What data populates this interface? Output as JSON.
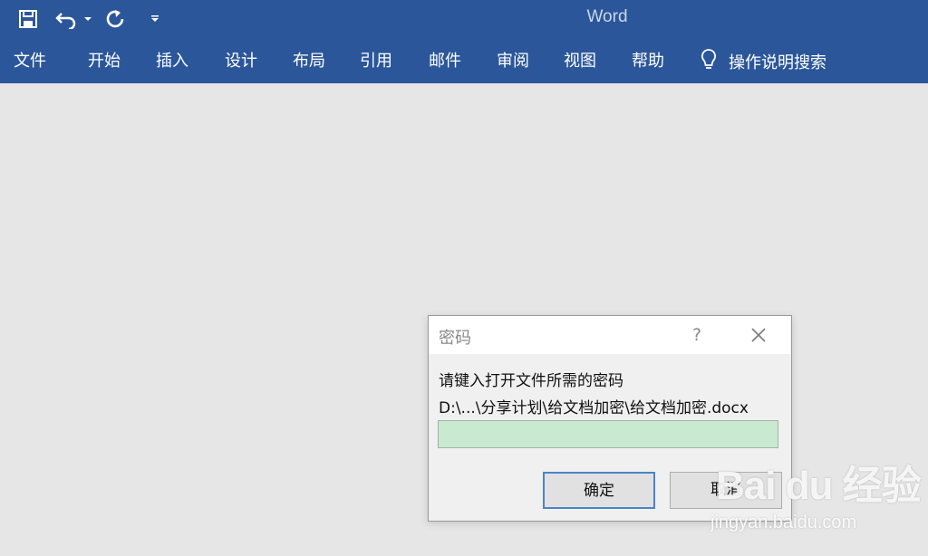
{
  "app": {
    "title": "Word"
  },
  "quick_access": {
    "icons": [
      "save-icon",
      "undo-icon",
      "dropdown-arrow-icon",
      "redo-icon",
      "customize-qat-icon"
    ]
  },
  "ribbon": {
    "tabs": [
      {
        "label": "文件"
      },
      {
        "label": "开始"
      },
      {
        "label": "插入"
      },
      {
        "label": "设计"
      },
      {
        "label": "布局"
      },
      {
        "label": "引用"
      },
      {
        "label": "邮件"
      },
      {
        "label": "审阅"
      },
      {
        "label": "视图"
      },
      {
        "label": "帮助"
      }
    ],
    "tell_me": {
      "label": "操作说明搜索",
      "icon": "lightbulb-icon"
    }
  },
  "dialog": {
    "title": "密码",
    "help_label": "?",
    "prompt": "请键入打开文件所需的密码",
    "file_path": "D:\\...\\分享计划\\给文档加密\\给文档加密.docx",
    "password_value": "",
    "ok_label": "确定",
    "cancel_label": "取消"
  },
  "watermark": {
    "logo": "Bai du 经验",
    "url": "jingyan.baidu.com"
  },
  "colors": {
    "ribbon_blue": "#2b579a",
    "workspace_gray": "#e6e6e6",
    "input_green": "#c9e9d1",
    "focus_blue": "#4a84c8"
  }
}
